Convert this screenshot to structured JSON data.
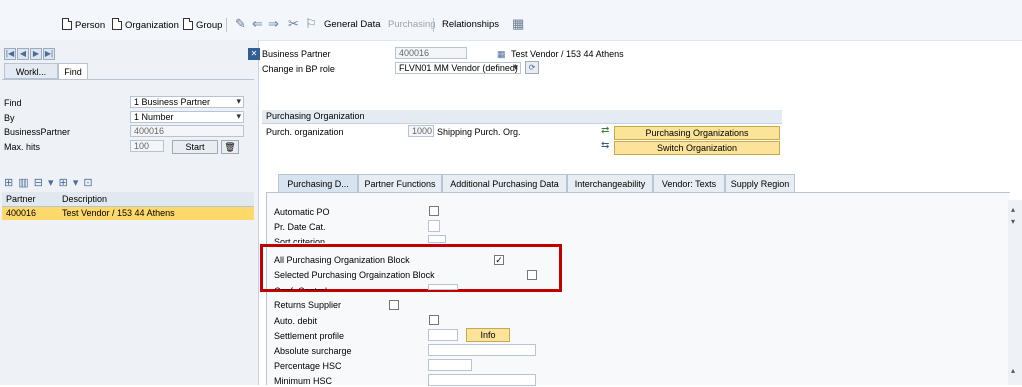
{
  "toolbar": {
    "person": "Person",
    "organization": "Organization",
    "group": "Group",
    "general_data": "General Data",
    "purchasing": "Purchasing",
    "relationships": "Relationships"
  },
  "left": {
    "tabs": [
      "Workl...",
      "Find"
    ],
    "find_label": "Find",
    "find_value": "1 Business Partner",
    "by_label": "By",
    "by_value": "1 Number",
    "bp_label": "BusinessPartner",
    "bp_value": "400016",
    "maxhits_label": "Max. hits",
    "maxhits_value": "100",
    "start": "Start",
    "result_headers": [
      "Partner",
      "Description"
    ],
    "result_row": {
      "partner": "400016",
      "description": "Test Vendor / 153 44 Athens"
    }
  },
  "header": {
    "bp_label": "Business Partner",
    "bp_value": "400016",
    "bp_desc": "Test Vendor / 153 44 Athens",
    "role_label": "Change in BP role",
    "role_value": "FLVN01 MM Vendor (defined)"
  },
  "purch_org": {
    "section_title": "Purchasing Organization",
    "label": "Purch. organization",
    "code": "1000",
    "name": "Shipping Purch. Org.",
    "btn_orgs": "Purchasing Organizations",
    "btn_switch": "Switch Organization"
  },
  "tabs": [
    "Purchasing D...",
    "Partner Functions",
    "Additional Purchasing Data",
    "Interchangeability",
    "Vendor: Texts",
    "Supply Region"
  ],
  "fields": {
    "auto_po": "Automatic PO",
    "pr_date_cat": "Pr. Date Cat.",
    "sort_criterion": "Sort criterion",
    "all_block": "All Purchasing Organization Block",
    "sel_block": "Selected Purchasing Orgainzation Block",
    "conf_control": "Conf. Control",
    "returns_supplier": "Returns Supplier",
    "auto_debit": "Auto. debit",
    "settlement_profile": "Settlement profile",
    "info": "Info",
    "absolute_surcharge": "Absolute surcharge",
    "percentage_hsc": "Percentage HSC",
    "minimum_hsc": "Minimum HSC"
  },
  "state": {
    "all_block_checked": true,
    "sel_block_checked": false
  },
  "colors": {
    "highlight": "#c00000",
    "button_yellow": "#fbe49a",
    "selected_row": "#fdd96b"
  }
}
